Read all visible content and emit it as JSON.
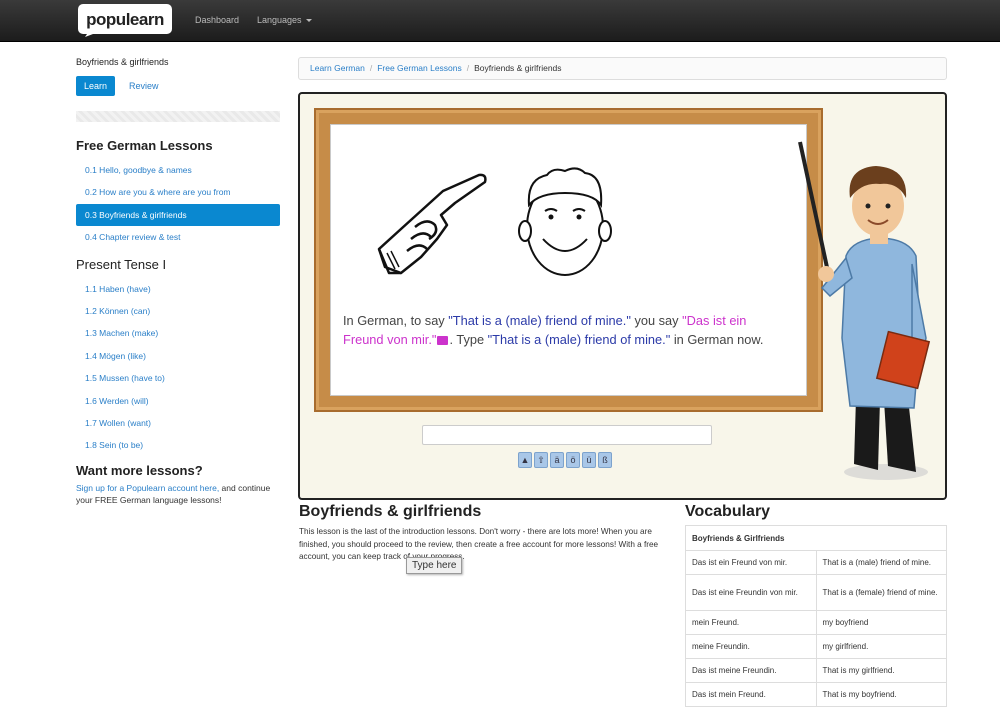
{
  "nav": {
    "logo_text": "populearn",
    "dashboard": "Dashboard",
    "languages": "Languages"
  },
  "sidebar": {
    "title": "Boyfriends & girlfriends",
    "tabs": {
      "learn": "Learn",
      "review": "Review"
    },
    "groups": [
      {
        "heading": "Free German Lessons",
        "items": [
          "0.1 Hello, goodbye & names",
          "0.2 How are you & where are you from",
          "0.3 Boyfriends & girlfriends",
          "0.4 Chapter review & test"
        ]
      },
      {
        "heading": "Present Tense I",
        "items": [
          "1.1 Haben (have)",
          "1.2 Können (can)",
          "1.3 Machen (make)",
          "1.4 Mögen (like)",
          "1.5 Mussen (have to)",
          "1.6 Werden (will)",
          "1.7 Wollen (want)",
          "1.8 Sein (to be)"
        ]
      }
    ],
    "more": {
      "heading": "Want more lessons?",
      "link": "Sign up for a Populearn account here,",
      "text": " and continue your FREE German language lessons!"
    }
  },
  "breadcrumb": {
    "items": [
      "Learn German",
      "Free German Lessons"
    ],
    "current": "Boyfriends & girlfriends"
  },
  "lesson": {
    "prompt_1": "In German, to say ",
    "question": "\"That is a (male) friend of mine.\"",
    "prompt_2": " you say ",
    "answer": "\"Das ist ein Freund von mir.\"",
    "prompt_3": ". Type ",
    "question_again": "\"That is a (male) friend of mine.\"",
    "prompt_4": " in German now.",
    "answer_placeholder": "",
    "special_keys": [
      "ä",
      "ö",
      "ü",
      "ß"
    ]
  },
  "description": {
    "heading": "Boyfriends & girlfriends",
    "text": "This lesson is the last of the introduction lessons. Don't worry - there are lots more! When you are finished, you should proceed to the review, then create a free account for more lessons! With a free account, you can keep track of your progress.",
    "tooltip": "Type here"
  },
  "vocabulary": {
    "heading": "Vocabulary",
    "table_title": "Boyfriends & Girlfriends",
    "rows": [
      [
        "Das ist ein Freund von mir.",
        "That is a (male) friend of mine."
      ],
      [
        "Das ist eine Freundin von mir.",
        "That is a (female) friend of mine."
      ],
      [
        "mein Freund.",
        "my boyfriend"
      ],
      [
        "meine Freundin.",
        "my girlfriend."
      ],
      [
        "Das ist meine Freundin.",
        "That is my girlfriend."
      ],
      [
        "Das ist mein Freund.",
        "That is my boyfriend."
      ]
    ]
  },
  "colors": {
    "accent": "#0a88d0",
    "link": "#2a7fc8",
    "question": "#2b3aa8",
    "answer": "#cc33cc",
    "board_frame": "#c68c48"
  }
}
